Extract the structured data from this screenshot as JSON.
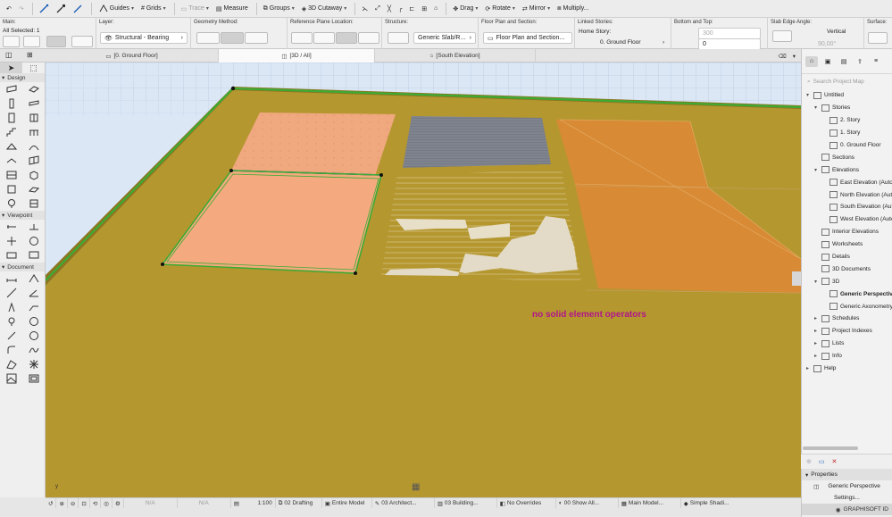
{
  "toolbar": {
    "guides": "Guides",
    "grids": "Grids",
    "trace": "Trace",
    "measure": "Measure",
    "groups": "Groups",
    "cutaway": "3D Cutaway",
    "drag": "Drag",
    "rotate": "Rotate",
    "mirror": "Mirror",
    "multiply": "Multiply..."
  },
  "infobox": {
    "main_label": "Main:",
    "selected": "All Selected: 1",
    "layer_label": "Layer:",
    "layer_value": "Structural - Bearing",
    "geometry_label": "Geometry Method:",
    "ref_plane_label": "Reference Plane Location:",
    "structure_label": "Structure:",
    "structure_value": "Generic Slab/R...",
    "floorplan_label": "Floor Plan and Section:",
    "floorplan_value": "Floor Plan and Section...",
    "linked_label": "Linked Stories:",
    "home_story_label": "Home Story:",
    "home_story_value": "0. Ground Floor",
    "bottom_top_label": "Bottom and Top:",
    "top_value": "300",
    "bottom_value": "0",
    "edge_angle_label": "Slab Edge Angle:",
    "edge_angle_mode": "Vertical",
    "edge_angle_value": "90,00°",
    "surface_label": "Surface:"
  },
  "tabs": {
    "t1": "[0. Ground Floor]",
    "t2": "[3D / All]",
    "t3": "[South Elevation]"
  },
  "toolbox": {
    "design": "Design",
    "viewpoint": "Viewpoint",
    "document": "Document"
  },
  "viewport": {
    "message": "no solid element operators",
    "axis_label": "y"
  },
  "status": {
    "na1": "N/A",
    "na2": "N/A",
    "scale": "1:100",
    "layer_combo": "02 Drafting",
    "model": "Entire Model",
    "architect": "03 Architect...",
    "building": "03 Building...",
    "overrides": "No Overrides",
    "show_all": "00 Show All...",
    "main_model": "Main Model...",
    "shading": "Simple Shadi..."
  },
  "navigator": {
    "search_placeholder": "Search Project Map",
    "tree": [
      {
        "label": "Untitled",
        "level": 0,
        "toggle": "▾",
        "icon": "project-icon"
      },
      {
        "label": "Stories",
        "level": 1,
        "toggle": "▾",
        "icon": "stories-icon"
      },
      {
        "label": "2. Story",
        "level": 2,
        "toggle": "",
        "icon": "story-icon"
      },
      {
        "label": "1. Story",
        "level": 2,
        "toggle": "",
        "icon": "story-icon"
      },
      {
        "label": "0. Ground Floor",
        "level": 2,
        "toggle": "",
        "icon": "story-icon"
      },
      {
        "label": "Sections",
        "level": 1,
        "toggle": "",
        "icon": "sections-icon"
      },
      {
        "label": "Elevations",
        "level": 1,
        "toggle": "▾",
        "icon": "elevations-icon"
      },
      {
        "label": "East Elevation (Auto",
        "level": 2,
        "toggle": "",
        "icon": "elevation-icon"
      },
      {
        "label": "North Elevation (Aut",
        "level": 2,
        "toggle": "",
        "icon": "elevation-icon"
      },
      {
        "label": "South Elevation (Auto",
        "level": 2,
        "toggle": "",
        "icon": "elevation-icon"
      },
      {
        "label": "West Elevation (Auto",
        "level": 2,
        "toggle": "",
        "icon": "elevation-icon"
      },
      {
        "label": "Interior Elevations",
        "level": 1,
        "toggle": "",
        "icon": "interior-elevations-icon"
      },
      {
        "label": "Worksheets",
        "level": 1,
        "toggle": "",
        "icon": "worksheets-icon"
      },
      {
        "label": "Details",
        "level": 1,
        "toggle": "",
        "icon": "details-icon"
      },
      {
        "label": "3D Documents",
        "level": 1,
        "toggle": "",
        "icon": "3d-documents-icon"
      },
      {
        "label": "3D",
        "level": 1,
        "toggle": "▾",
        "icon": "3d-icon"
      },
      {
        "label": "Generic Perspective",
        "level": 2,
        "toggle": "",
        "icon": "perspective-icon",
        "selected": true
      },
      {
        "label": "Generic Axonometry",
        "level": 2,
        "toggle": "",
        "icon": "axonometry-icon"
      },
      {
        "label": "Schedules",
        "level": 1,
        "toggle": "▸",
        "icon": "schedules-icon"
      },
      {
        "label": "Project Indexes",
        "level": 1,
        "toggle": "▸",
        "icon": "indexes-icon"
      },
      {
        "label": "Lists",
        "level": 1,
        "toggle": "▸",
        "icon": "lists-icon"
      },
      {
        "label": "Info",
        "level": 1,
        "toggle": "▸",
        "icon": "info-icon"
      },
      {
        "label": "Help",
        "level": 0,
        "toggle": "▸",
        "icon": "help-icon"
      }
    ]
  },
  "properties": {
    "header": "Properties",
    "view_name": "Generic Perspective",
    "settings": "Settings...",
    "graphisoft": "GRAPHISOFT ID"
  },
  "colors": {
    "ground": "#b5972f",
    "slab_selected": "#f4aa7e",
    "selection_green": "#3cab34",
    "message": "#b0168a",
    "sky": "#dbe7f5"
  }
}
